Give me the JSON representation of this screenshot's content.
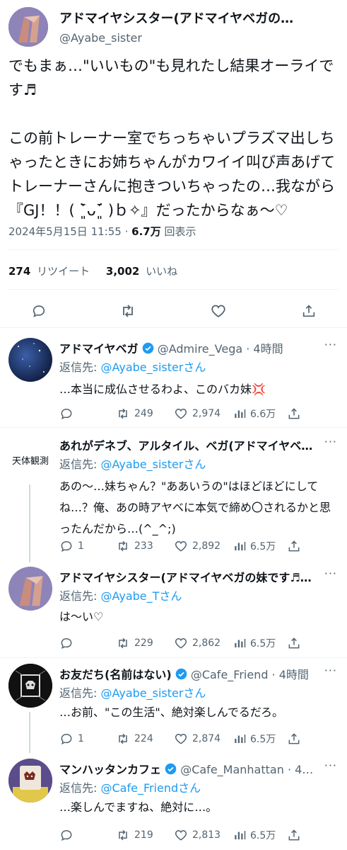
{
  "main_tweet": {
    "name": "アドマイヤシスター(アドマイヤベガの妹です…",
    "handle": "@Ayabe_sister",
    "body": "でもまぁ…\"いいもの\"も見れたし結果オーライです♬\n\nこの前トレーナー室でちっちゃいプラズマ出しちゃったときにお姉ちゃんがカワイイ叫び声あげてトレーナーさんに抱きついちゃったの…我ながら『GJ！！( ˉ͈̀ᴗˉ͈́ )ｂ✧』だったからなぁ〜♡",
    "date": "2024年5月15日 11:55",
    "dot": "·",
    "views_num": "6.7万",
    "views_label": "回表示",
    "retweets_num": "274",
    "retweets_label": "リツイート",
    "likes_num": "3,002",
    "likes_label": "いいね"
  },
  "replies": [
    {
      "name": "アドマイヤベガ",
      "verified": true,
      "handle": "@Admire_Vega",
      "time": "· 4時間",
      "more": "···",
      "reply_prefix": "返信先: ",
      "reply_to": "@Ayabe_sisterさん",
      "text": "…本当に成仏させるわよ、このバカ妹💢",
      "replies": "",
      "retweets": "249",
      "likes": "2,974",
      "views": "6.6万"
    },
    {
      "name": "あれがデネブ、アルタイル、ベガ(アドマイヤベ…",
      "verified": false,
      "avatar_text": "天体観測",
      "handle": "",
      "time": "",
      "more": "···",
      "reply_prefix": "返信先: ",
      "reply_to": "@Ayabe_sisterさん",
      "text": "あの〜…妹ちゃん？\"ああいうの\"はほどほどにしてね…？俺、あの時アヤベに本気で締め〇されるかと思ったんだから…(^_^;)",
      "replies": "1",
      "retweets": "233",
      "likes": "2,892",
      "views": "6.5万"
    },
    {
      "name": "アドマイヤシスター(アドマイヤベガの妹です♬…",
      "verified": false,
      "handle": "",
      "time": "",
      "more": "···",
      "reply_prefix": "返信先: ",
      "reply_to": "@Ayabe_Tさん",
      "text": "は〜い♡",
      "replies": "",
      "retweets": "229",
      "likes": "2,862",
      "views": "6.5万"
    },
    {
      "name": "お友だち(名前はない)",
      "verified": true,
      "handle": "@Cafe_Friend",
      "time": "· 4時間",
      "more": "···",
      "reply_prefix": "返信先: ",
      "reply_to": "@Ayabe_sisterさん",
      "text": "…お前、\"この生活\"、絶対楽しんでるだろ。",
      "replies": "1",
      "retweets": "224",
      "likes": "2,874",
      "views": "6.5万"
    },
    {
      "name": "マンハッタンカフェ",
      "verified": true,
      "handle": "@Cafe_Manhattan",
      "time": "· 4…",
      "more": "···",
      "reply_prefix": "返信先: ",
      "reply_to": "@Cafe_Friendさん",
      "text": "…楽しんでますね、絶対に…。",
      "replies": "",
      "retweets": "219",
      "likes": "2,813",
      "views": "6.5万"
    }
  ],
  "icons": [
    "reply-icon",
    "retweet-icon",
    "like-icon",
    "share-icon",
    "views-icon",
    "verified-badge-icon",
    "more-icon"
  ],
  "colors": {
    "link": "#1d9bf0",
    "muted": "#536471",
    "text": "#0f1419",
    "verified": "#1d9bf0"
  }
}
